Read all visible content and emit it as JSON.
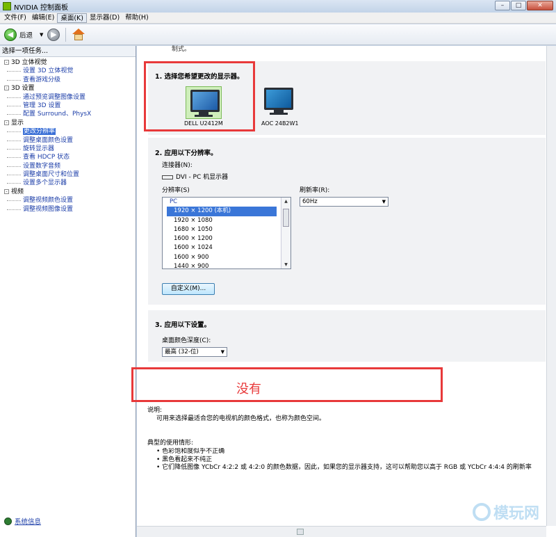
{
  "window": {
    "title": "NVIDIA 控制面板",
    "min": "–",
    "max": "□",
    "close": "✕"
  },
  "menu": [
    "文件(F)",
    "编辑(E)",
    "桌面(K)",
    "显示器(D)",
    "帮助(H)"
  ],
  "toolbar": {
    "back_label": "后退",
    "back_glyph": "◀",
    "forward_glyph": "▶",
    "dropdown_glyph": "▼"
  },
  "left": {
    "header": "选择一项任务...",
    "tree": [
      {
        "type": "cat",
        "label": "3D 立体视觉"
      },
      {
        "type": "link",
        "label": "设置 3D 立体视觉"
      },
      {
        "type": "link",
        "label": "查看游戏分级"
      },
      {
        "type": "cat",
        "label": "3D 设置"
      },
      {
        "type": "link",
        "label": "通过预览调整图像设置"
      },
      {
        "type": "link",
        "label": "管理 3D 设置"
      },
      {
        "type": "link",
        "label": "配置 Surround、PhysX"
      },
      {
        "type": "cat",
        "label": "显示"
      },
      {
        "type": "link",
        "label": "更改分辨率",
        "selected": true
      },
      {
        "type": "link",
        "label": "调整桌面颜色设置"
      },
      {
        "type": "link",
        "label": "旋转显示器"
      },
      {
        "type": "link",
        "label": "查看 HDCP 状态"
      },
      {
        "type": "link",
        "label": "设置数字音频"
      },
      {
        "type": "link",
        "label": "调整桌面尺寸和位置"
      },
      {
        "type": "link",
        "label": "设置多个显示器"
      },
      {
        "type": "cat",
        "label": "视频"
      },
      {
        "type": "link",
        "label": "调整视频颜色设置"
      },
      {
        "type": "link",
        "label": "调整视频图像设置"
      }
    ],
    "tree_toggle": "-",
    "system_info": "系统信息"
  },
  "main": {
    "intro": "制式。",
    "section1_title": "1. 选择您希望更改的显示器。",
    "monitors": [
      "DELL U2412M",
      "AOC 24B2W1"
    ],
    "section2_title": "2. 应用以下分辨率。",
    "connector_label": "连接器(N):",
    "connector_value": "DVI - PC 机显示器",
    "resolution_label": "分辨率(S)",
    "refresh_label": "刷新率(R):",
    "refresh_value": "60Hz",
    "resolutions": [
      {
        "label": "PC",
        "group": true
      },
      {
        "label": "1920 × 1200 (本机)",
        "selected": true
      },
      {
        "label": "1920 × 1080"
      },
      {
        "label": "1680 × 1050"
      },
      {
        "label": "1600 × 1200"
      },
      {
        "label": "1600 × 1024"
      },
      {
        "label": "1600 × 900"
      },
      {
        "label": "1440 × 900"
      }
    ],
    "customize_button": "自定义(M)...",
    "section3_title": "3. 应用以下设置。",
    "color_depth_label": "桌面颜色深度(C):",
    "color_depth_value": "最高 (32-位)",
    "annotation": "没有",
    "description_title": "说明:",
    "description_text": "可用来选择最适合您的电视机的颜色格式，也称为颜色空间。",
    "typical_title": "典型的使用情形:",
    "typical_items": [
      "色彩饱和度似乎不正确",
      "黑色看起来不纯正",
      "它们降低图像 YCbCr 4:2:2 或 4:2:0 的颜色数据，因此，如果您的显示器支持，这可以帮助您以高于 RGB 或 YCbCr 4:4:4 的刷新率"
    ],
    "watermark": "模玩网"
  },
  "colors": {
    "accent": "#3a76d8",
    "highlight_red": "#e8393a",
    "nvidia_green": "#76b900"
  }
}
